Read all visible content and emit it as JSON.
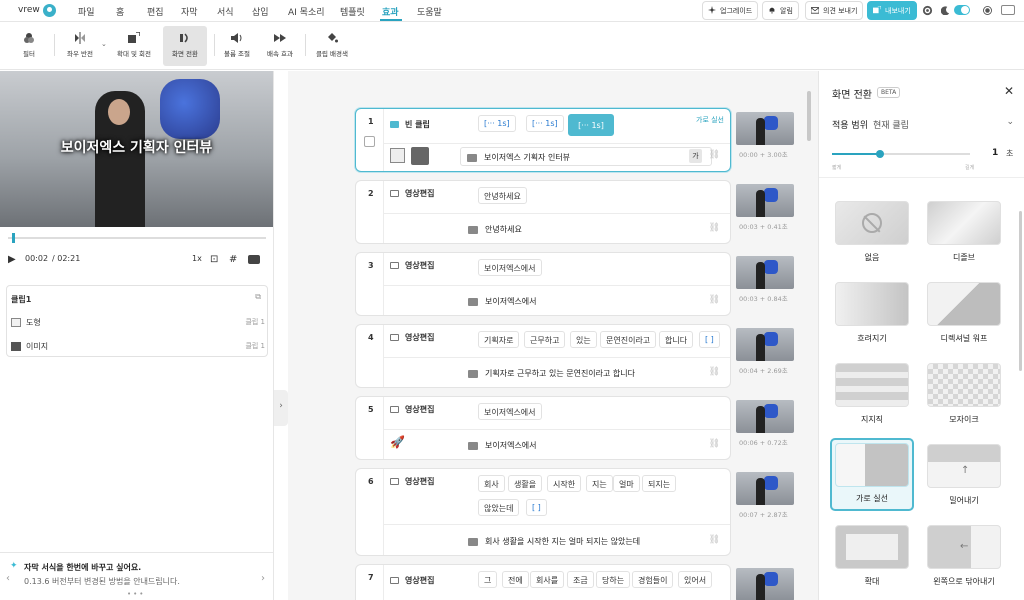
{
  "menubar": {
    "app": "vrew",
    "items": [
      "파일",
      "홈",
      "편집",
      "자막",
      "서식",
      "삽입",
      "AI 목소리",
      "템플릿",
      "효과",
      "도움말"
    ],
    "active": "효과",
    "upgrade": "업그레이드",
    "alarm": "알림",
    "feedback": "의견 보내기",
    "export": "내보내기"
  },
  "toolbar": {
    "items": [
      "필터",
      "좌우 반전",
      "확대 및 회전",
      "화면 전환",
      "볼륨 조절",
      "배속 효과",
      "클립 배경색"
    ],
    "selected": "화면 전환"
  },
  "preview": {
    "caption": "보이저엑스 기획자 인터뷰",
    "time_current": "00:02",
    "time_total": "/ 02:21",
    "speed": "1x",
    "progress": 0.014
  },
  "clip_panel": {
    "title": "클립1",
    "rows": [
      {
        "name": "도형",
        "clip": "클립 1"
      },
      {
        "name": "이미지",
        "clip": "클립 1"
      }
    ]
  },
  "tip": {
    "title": "자막 서식을 한번에 바꾸고 싶어요.",
    "body": "0.13.6 버전부터 변경된 방법을 안내드립니다."
  },
  "clips": [
    {
      "num": "1",
      "title": "빈 클립",
      "badge": "가로 실선",
      "chips": [
        "[··· 1s]",
        "[··· 1s]",
        "[··· 1s]"
      ],
      "subtitle": "보이저엑스 기획자 인터뷰",
      "sub_btn": "가",
      "thumb_time": "00:00 + 3.00초"
    },
    {
      "num": "2",
      "title": "영상편집",
      "words": [
        "안녕하세요"
      ],
      "subtitle": "안녕하세요",
      "thumb_time": "00:03 + 0.41초"
    },
    {
      "num": "3",
      "title": "영상편집",
      "words": [
        "보이저엑스에서"
      ],
      "subtitle": "보이저엑스에서",
      "thumb_time": "00:03 + 0.84초"
    },
    {
      "num": "4",
      "title": "영상편집",
      "words": [
        "기획자로",
        "근무하고",
        "있는",
        "문연진이라고",
        "합니다",
        "[ ]"
      ],
      "subtitle": "기획자로 근무하고 있는 문연진이라고 합니다",
      "thumb_time": "00:04 + 2.69초"
    },
    {
      "num": "5",
      "title": "영상편집",
      "words": [
        "보이저엑스에서"
      ],
      "subtitle": "보이저엑스에서",
      "thumb_time": "00:06 + 0.72초"
    },
    {
      "num": "6",
      "title": "영상편집",
      "words": [
        "회사",
        "생활을",
        "시작한",
        "지는",
        "얼마",
        "되지는",
        "않았는데",
        "[ ]"
      ],
      "subtitle": "회사 생활을 시작한 지는 얼마 되지는 않았는데",
      "thumb_time": "00:07 + 2.87초"
    },
    {
      "num": "7",
      "title": "영상편집",
      "words": [
        "그",
        "전에",
        "회사를",
        "조금",
        "당하는",
        "경험들이",
        "있어서"
      ],
      "subtitle": "",
      "thumb_time": ""
    }
  ],
  "transition_panel": {
    "title": "화면 전환",
    "beta": "BETA",
    "scope_label": "적용 범위",
    "scope_value": "현재 클립",
    "duration_value": "1",
    "duration_unit": "초",
    "duration_fraction": 0.35,
    "tick_min": "짧게",
    "tick_max": "길게",
    "items": [
      {
        "label": "없음"
      },
      {
        "label": "디졸브"
      },
      {
        "label": "흐려지기"
      },
      {
        "label": "디렉셔널 워프"
      },
      {
        "label": "지지직"
      },
      {
        "label": "모자이크"
      },
      {
        "label": "가로 실선",
        "selected": true
      },
      {
        "label": "밀어내기"
      },
      {
        "label": "확대"
      },
      {
        "label": "왼쪽으로 닦아내기"
      }
    ]
  }
}
